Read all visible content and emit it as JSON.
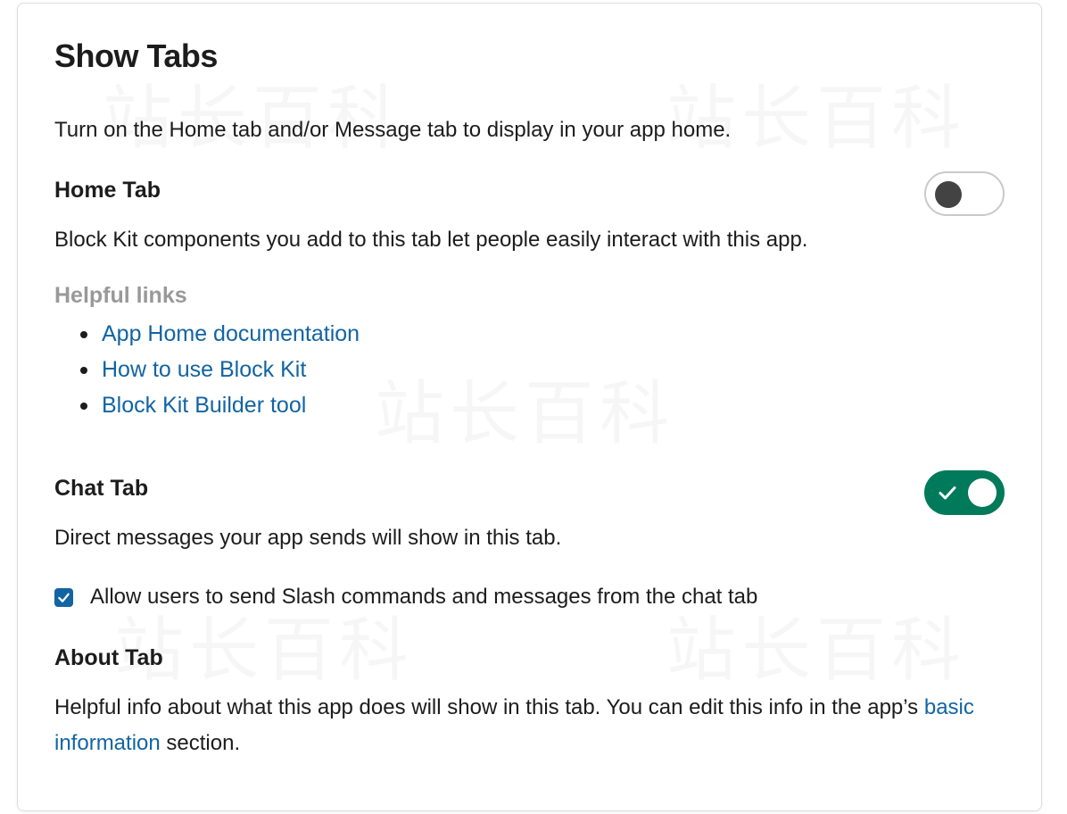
{
  "page": {
    "title": "Show Tabs",
    "intro": "Turn on the Home tab and/or Message tab to display in your app home."
  },
  "home_tab": {
    "heading": "Home Tab",
    "enabled": false,
    "description": "Block Kit components you add to this tab let people easily interact with this app.",
    "helpful_links_title": "Helpful links",
    "links": [
      "App Home documentation",
      "How to use Block Kit",
      "Block Kit Builder tool"
    ]
  },
  "chat_tab": {
    "heading": "Chat Tab",
    "enabled": true,
    "description": "Direct messages your app sends will show in this tab.",
    "checkbox_label": "Allow users to send Slash commands and messages from the chat tab",
    "checkbox_checked": true
  },
  "about_tab": {
    "heading": "About Tab",
    "description_part1": "Helpful info about what this app does will show in this tab. You can edit this info in the app’s ",
    "link_text": "basic information",
    "description_part2": " section."
  },
  "watermark": "站长百科",
  "colors": {
    "link": "#1264a3",
    "toggle_on": "#007a5a",
    "toggle_off_knob": "#434343",
    "checkbox": "#1264a3",
    "muted": "#999999"
  },
  "icons": {
    "toggle_on_indicator": "checkmark-icon",
    "checkbox_indicator": "checkmark-icon",
    "list_bullet": "bullet-icon"
  }
}
